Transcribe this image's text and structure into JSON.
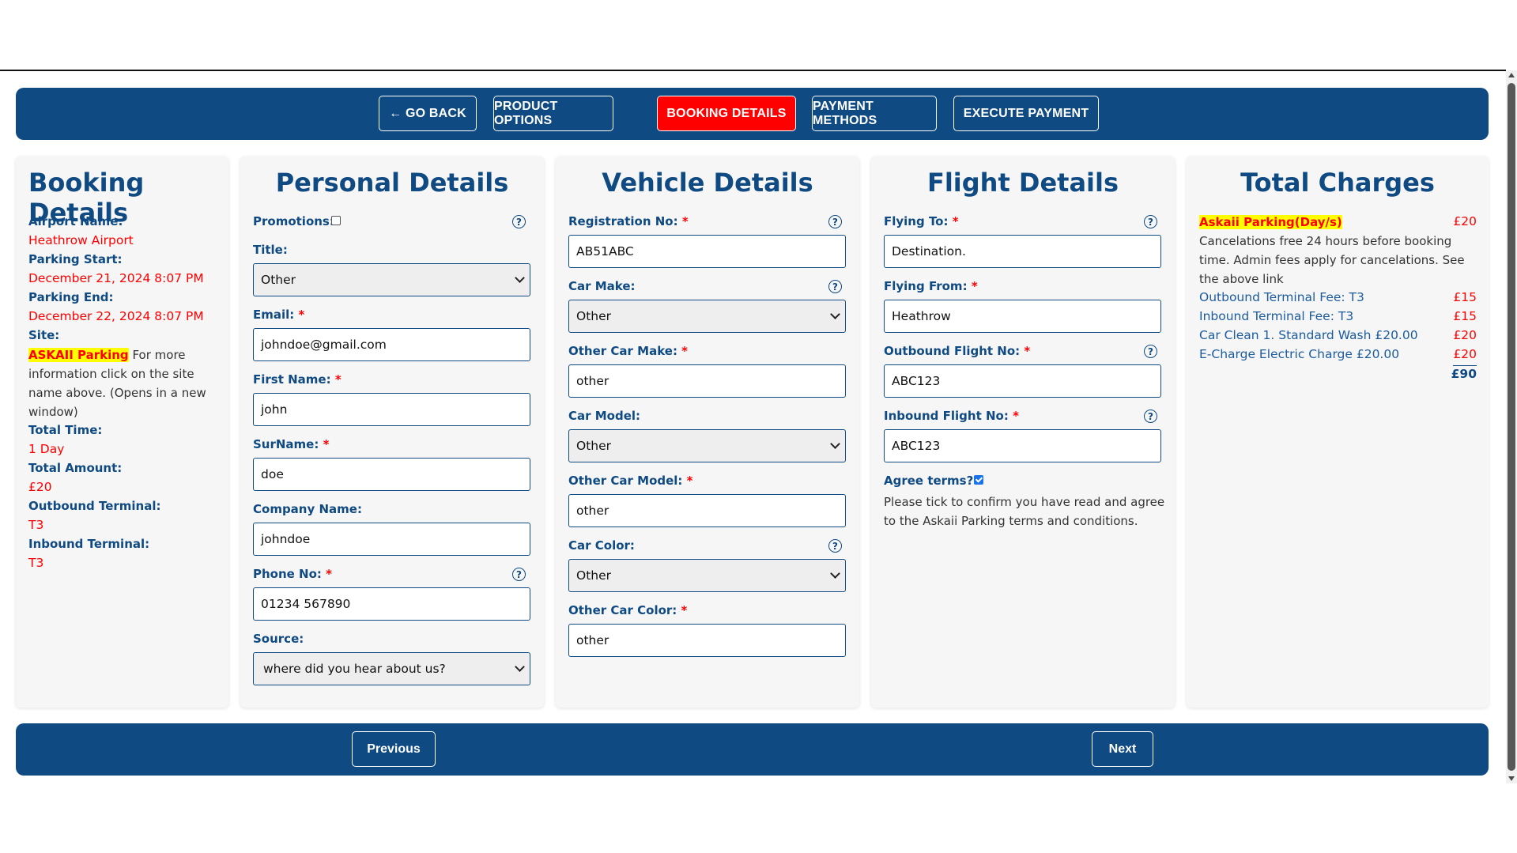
{
  "nav": {
    "go_back": "← GO BACK",
    "product_options": "PRODUCT OPTIONS",
    "booking_details": "BOOKING DETAILS",
    "payment_methods": "PAYMENT METHODS",
    "execute_payment": "EXECUTE PAYMENT",
    "active_tab": "BOOKING DETAILS"
  },
  "booking": {
    "title": "Booking Details",
    "airport_label": "Airport Name:",
    "airport_value": "Heathrow Airport",
    "start_label": "Parking Start:",
    "start_value": "December 21, 2024 8:07 PM",
    "end_label": "Parking End:",
    "end_value": "December 22, 2024 8:07 PM",
    "site_label": "Site:",
    "site_link": "ASKAII Parking",
    "site_text_1": " For more",
    "site_text_2": "information click on the site",
    "site_text_3": "name above. (Opens in a new",
    "site_text_4": "window)",
    "total_time_label": "Total Time:",
    "total_time_value": "1 Day",
    "total_amount_label": "Total Amount:",
    "total_amount_value": "£20",
    "outbound_label": "Outbound Terminal:",
    "outbound_value": "T3",
    "inbound_label": "Inbound Terminal:",
    "inbound_value": "T3"
  },
  "personal": {
    "title": "Personal Details",
    "promotions_label": "Promotions:",
    "promotions_checked": false,
    "title_label": "Title:",
    "title_value": "Other",
    "email_label": "Email:",
    "email_value": "johndoe@gmail.com",
    "first_name_label": "First Name:",
    "first_name_value": "john",
    "surname_label": "SurName:",
    "surname_value": "doe",
    "company_label": "Company Name:",
    "company_value": "johndoe",
    "phone_label": "Phone No:",
    "phone_value": "01234 567890",
    "source_label": "Source:",
    "source_value": "where did you hear about us?"
  },
  "vehicle": {
    "title": "Vehicle Details",
    "reg_label": "Registration No:",
    "reg_value": "AB51ABC",
    "make_label": "Car Make:",
    "make_value": "Other",
    "other_make_label": "Other Car Make:",
    "other_make_value": "other",
    "model_label": "Car Model:",
    "model_value": "Other",
    "other_model_label": "Other Car Model:",
    "other_model_value": "other",
    "color_label": "Car Color:",
    "color_value": "Other",
    "other_color_label": "Other Car Color:",
    "other_color_value": "other"
  },
  "flight": {
    "title": "Flight Details",
    "to_label": "Flying To:",
    "to_value": "Destination.",
    "from_label": "Flying From:",
    "from_value": "Heathrow",
    "outbound_label": "Outbound Flight No:",
    "outbound_value": "ABC123",
    "inbound_label": "Inbound Flight No:",
    "inbound_value": "ABC123",
    "agree_label": "Agree terms?",
    "agree_checked": true,
    "agree_text_1": "Please tick to confirm you have read and agree",
    "agree_text_2": "to the Askaii Parking terms and conditions."
  },
  "charges": {
    "title": "Total Charges",
    "main_name": "Askaii Parking(Day/s)",
    "main_amount": "£20",
    "note_1": "Cancelations free 24 hours before booking",
    "note_2": "time. Admin fees apply for cancelations. See",
    "note_3": "the above link",
    "items": [
      {
        "name": "Outbound Terminal Fee: T3",
        "amount": "£15"
      },
      {
        "name": "Inbound Terminal Fee: T3",
        "amount": "£15"
      },
      {
        "name": "Car Clean 1. Standard Wash £20.00",
        "amount": "£20"
      },
      {
        "name": "E-Charge Electric Charge £20.00",
        "amount": "£20"
      }
    ],
    "total": "£90"
  },
  "footer": {
    "previous": "Previous",
    "next": "Next"
  },
  "colors": {
    "brand": "#0f4a82",
    "active": "#ff0000",
    "highlight": "#ffff00"
  },
  "icons": {
    "help": "question-circle-icon",
    "back_arrow": "arrow-left"
  }
}
